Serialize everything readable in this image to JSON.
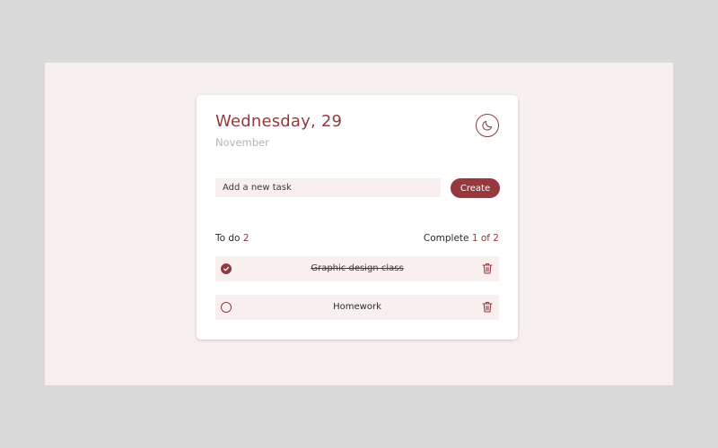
{
  "header": {
    "day_title": "Wednesday, 29",
    "month": "November",
    "theme_icon": "moon-icon"
  },
  "new_task": {
    "placeholder": "Add a new task",
    "value": "",
    "create_label": "Create"
  },
  "summary": {
    "todo_label": "To do",
    "todo_count": "2",
    "complete_label": "Complete",
    "complete_count": "1 of 2"
  },
  "tasks": [
    {
      "text": "Graphic design class",
      "done": true,
      "delete_icon": "trash-icon"
    },
    {
      "text": "Homework",
      "done": false,
      "delete_icon": "trash-icon"
    }
  ],
  "colors": {
    "accent": "#95393f",
    "background": "#f8f0ef",
    "card": "#ffffff",
    "muted": "#b9b1b1"
  }
}
